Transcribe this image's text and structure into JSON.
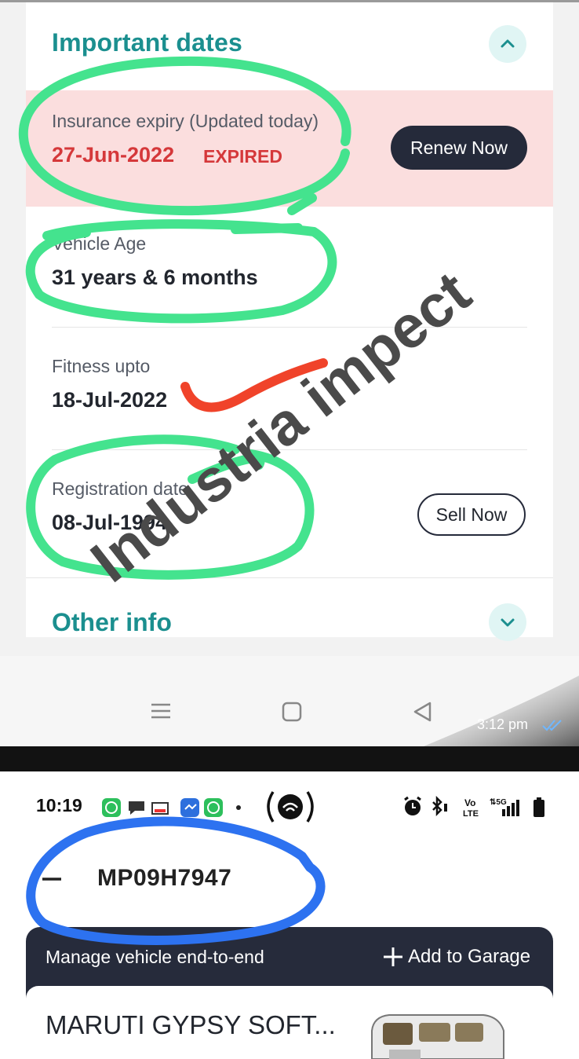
{
  "vehicle_dates_screen": {
    "section_title": "Important dates",
    "insurance": {
      "label": "Insurance expiry (Updated today)",
      "value": "27-Jun-2022",
      "status": "EXPIRED",
      "action": "Renew Now"
    },
    "vehicle_age": {
      "label": "Vehicle Age",
      "value": "31 years & 6 months"
    },
    "fitness": {
      "label": "Fitness upto",
      "value": "18-Jul-2022"
    },
    "registration": {
      "label": "Registration date",
      "value": "08-Jul-1994",
      "action": "Sell Now"
    },
    "other_section_title": "Other info",
    "message_time": "3:12 pm"
  },
  "vehicle_header_screen": {
    "status_time": "10:19",
    "status_icons": [
      "whatsapp-icon",
      "chat-icon",
      "news-icon",
      "messenger-icon",
      "whatsapp-icon",
      "dot-icon",
      "hotspot-icon",
      "alarm-icon",
      "bluetooth-icon",
      "volte-icon",
      "signal-5g-icon",
      "battery-icon"
    ],
    "network_label": "Vo LTE",
    "network_gen": "5G",
    "plate_number": "MP09H7947",
    "banner_text": "Manage vehicle end-to-end",
    "add_to_garage": "Add to Garage",
    "car_name": "MARUTI GYPSY SOFT..."
  },
  "watermark": "Industria impect",
  "colors": {
    "accent_teal": "#1b8f8f",
    "expired_red": "#d5383a",
    "dark_navy": "#252a3a",
    "marker_green": "#44e38e",
    "marker_blue": "#2d72f0",
    "marker_red": "#f0432a"
  }
}
